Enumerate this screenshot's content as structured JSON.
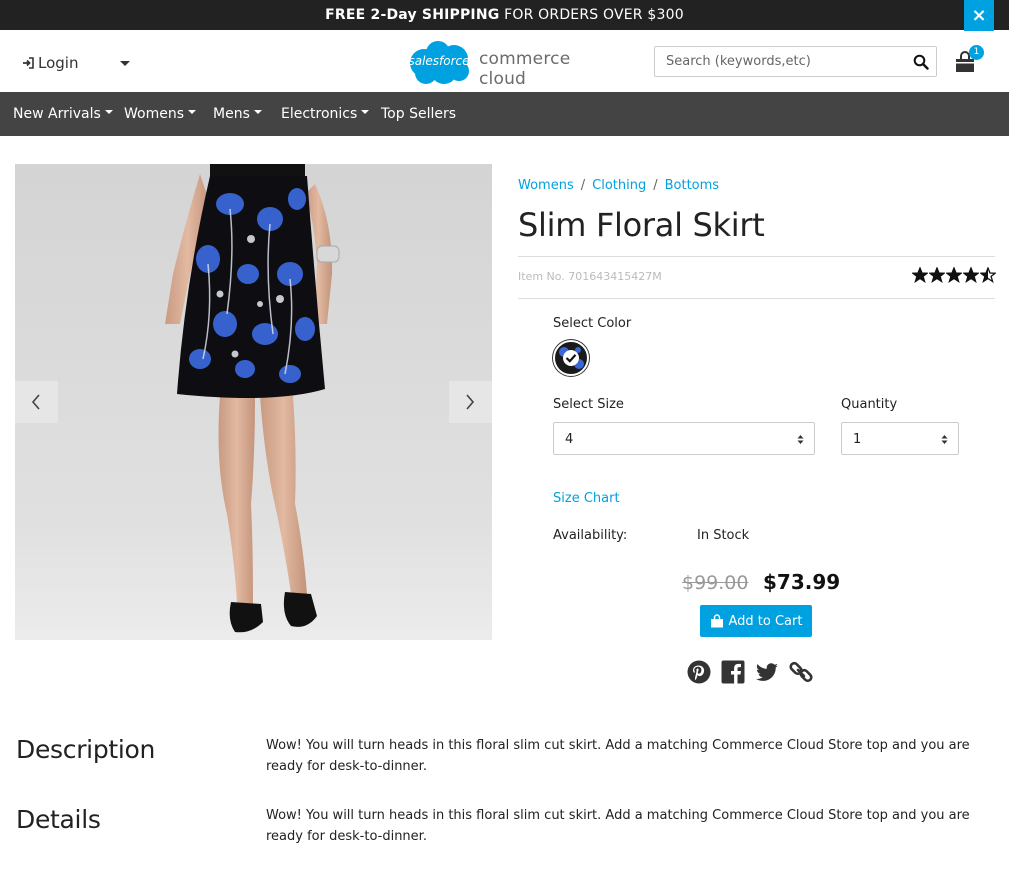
{
  "promo": {
    "bold": "FREE 2-Day SHIPPING",
    "rest": " FOR ORDERS OVER $300",
    "close_glyph": "×"
  },
  "header": {
    "login_label": "Login",
    "logo_cloud_text": "salesforce",
    "logo_text": "commerce cloud",
    "search_placeholder": "Search (keywords,etc)",
    "cart_count": "1"
  },
  "nav": {
    "items": [
      {
        "label": "New Arrivals",
        "dropdown": true
      },
      {
        "label": "Womens",
        "dropdown": true
      },
      {
        "label": "Mens",
        "dropdown": true
      },
      {
        "label": "Electronics",
        "dropdown": true
      },
      {
        "label": "Top Sellers",
        "dropdown": false
      }
    ]
  },
  "breadcrumb": [
    "Womens",
    "Clothing",
    "Bottoms"
  ],
  "product": {
    "title": "Slim Floral Skirt",
    "item_no": "Item No. 701643415427M",
    "rating": 4.5,
    "rating_max": 5,
    "select_color_label": "Select Color",
    "select_size_label": "Select Size",
    "size_value": "4",
    "quantity_label": "Quantity",
    "quantity_value": "1",
    "size_chart_label": "Size Chart",
    "availability_label": "Availability:",
    "availability_value": "In Stock",
    "old_price": "$99.00",
    "price": "$73.99",
    "add_to_cart_label": "Add to Cart"
  },
  "social": [
    "pinterest-icon",
    "facebook-icon",
    "twitter-icon",
    "link-icon"
  ],
  "description": {
    "title": "Description",
    "body": "Wow! You will turn heads in this floral slim cut skirt. Add a matching Commerce Cloud Store top and you are ready for desk-to-dinner."
  },
  "details": {
    "title": "Details",
    "body": "Wow! You will turn heads in this floral slim cut skirt. Add a matching Commerce Cloud Store top and you are ready for desk-to-dinner."
  },
  "colors": {
    "accent": "#00a1e0",
    "nav_bg": "#444444",
    "promo_bg": "#222222"
  }
}
